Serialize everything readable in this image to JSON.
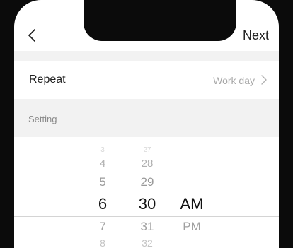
{
  "nav": {
    "next_label": "Next"
  },
  "repeat": {
    "label": "Repeat",
    "value": "Work day"
  },
  "setting": {
    "label": "Setting"
  },
  "picker": {
    "hours": [
      "3",
      "4",
      "5",
      "6",
      "7",
      "8"
    ],
    "minutes": [
      "27",
      "28",
      "29",
      "30",
      "31",
      "32"
    ],
    "ampm": [
      "AM",
      "PM"
    ],
    "selected": {
      "hour": "6",
      "minute": "30",
      "ampm": "AM"
    }
  },
  "icons": {
    "back": "chevron-left-icon",
    "repeat_chevron": "chevron-right-icon"
  }
}
